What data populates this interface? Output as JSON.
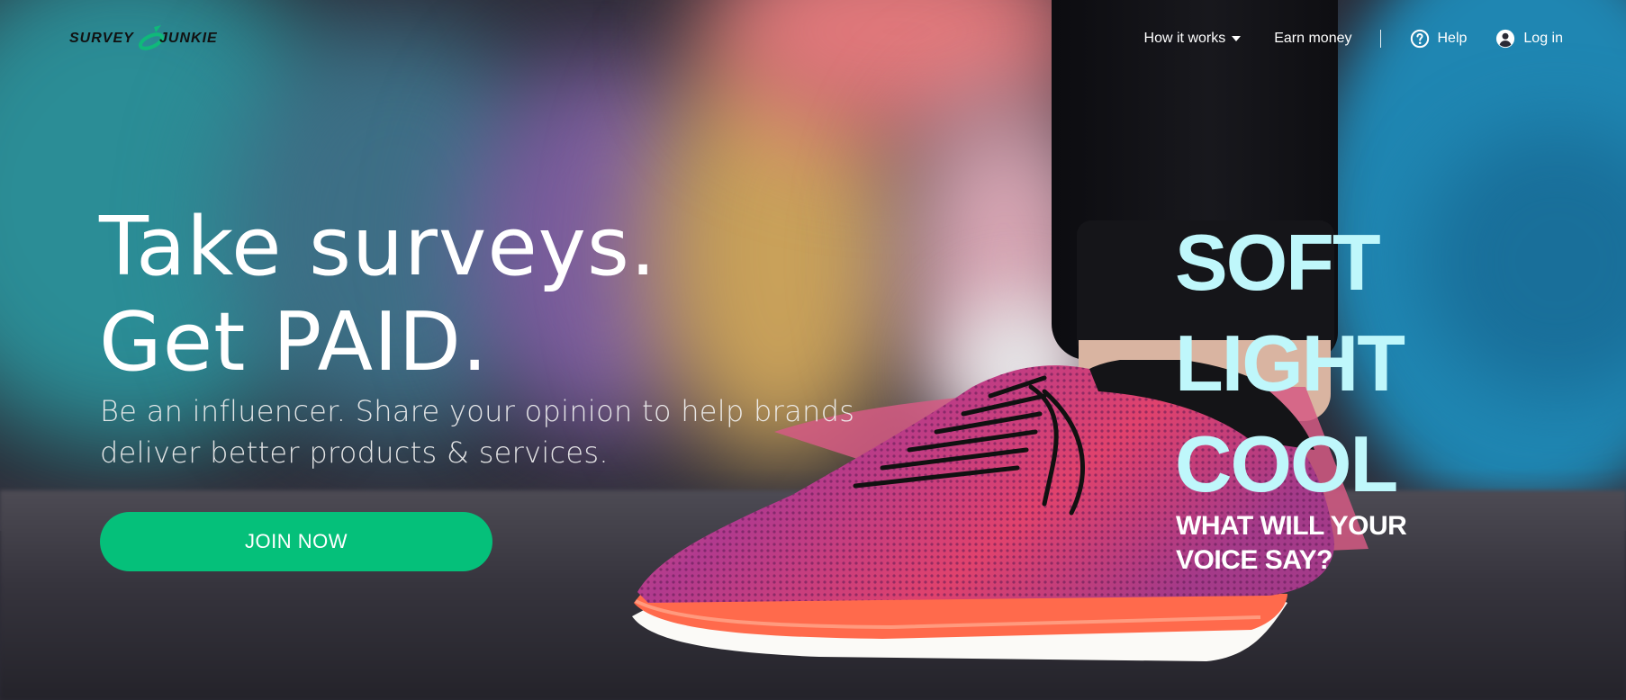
{
  "brand": {
    "logo_left": "SURVEY",
    "logo_right": "JUNKIE",
    "logo_icon": "swoosh-logo-icon"
  },
  "nav": {
    "how_it_works": "How it works",
    "earn_money": "Earn money",
    "help": "Help",
    "login": "Log in",
    "icons": {
      "help": "question-circle-icon",
      "login": "user-circle-icon",
      "dropdown": "caret-down-icon"
    }
  },
  "hero": {
    "title_line1": "Take surveys.",
    "title_line2": "Get PAID.",
    "subtitle": "Be an influencer. Share your opinion to help brands deliver better products & services.",
    "cta": "JOIN NOW"
  },
  "ad": {
    "lines": [
      "SOFT",
      "LIGHT",
      "COOL"
    ],
    "tagline_line1": "WHAT WILL YOUR",
    "tagline_line2": "VOICE SAY?"
  },
  "colors": {
    "cta": "#05c07a",
    "ad_text": "#bff7fb",
    "logo_accent": "#0fb97a"
  }
}
